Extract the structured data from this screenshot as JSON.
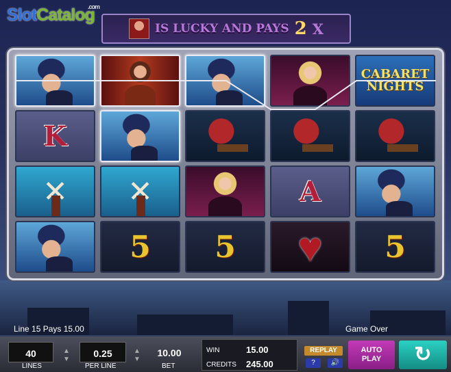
{
  "watermark": {
    "part1": "Slot",
    "part2": "Catalog",
    "suffix": ".com"
  },
  "banner": {
    "text": "IS LUCKY AND PAYS",
    "multiplier": "2",
    "x": "X"
  },
  "reels": [
    [
      {
        "symbol": "man",
        "win": true
      },
      {
        "symbol": "dancer",
        "win": true
      },
      {
        "symbol": "man",
        "win": true
      },
      {
        "symbol": "blonde",
        "win": false
      },
      {
        "symbol": "logo",
        "win": false
      }
    ],
    [
      {
        "symbol": "card",
        "label": "K",
        "win": false
      },
      {
        "symbol": "man",
        "win": true
      },
      {
        "symbol": "phonograph",
        "win": false
      },
      {
        "symbol": "phonograph",
        "win": false
      },
      {
        "symbol": "phonograph",
        "win": false
      }
    ],
    [
      {
        "symbol": "windmill",
        "win": false
      },
      {
        "symbol": "windmill",
        "win": false
      },
      {
        "symbol": "blonde",
        "win": false
      },
      {
        "symbol": "card",
        "label": "A",
        "win": false
      },
      {
        "symbol": "man",
        "win": false
      }
    ],
    [
      {
        "symbol": "man",
        "win": false
      },
      {
        "symbol": "five",
        "label": "5",
        "win": false
      },
      {
        "symbol": "five",
        "label": "5",
        "win": false
      },
      {
        "symbol": "heart",
        "win": false
      },
      {
        "symbol": "five",
        "label": "5",
        "win": false
      }
    ]
  ],
  "logo_symbol": {
    "line1": "CABARET",
    "line2": "NIGHTS"
  },
  "status": {
    "line_pays": "Line 15 Pays 15.00",
    "game_state": "Game Over"
  },
  "controls": {
    "lines": {
      "value": "40",
      "label": "LINES"
    },
    "per_line": {
      "value": "0.25",
      "label": "PER LINE"
    },
    "bet": {
      "value": "10.00",
      "label": "BET"
    },
    "win_label": "WIN",
    "win_value": "15.00",
    "credits_label": "CREDITS",
    "credits_value": "245.00",
    "replay": "REPLAY",
    "help": "?",
    "sound_icon": "speaker-icon",
    "autoplay_1": "AUTO",
    "autoplay_2": "PLAY",
    "spin_icon": "refresh-arrow-icon"
  },
  "colors": {
    "accent": "#b778d9",
    "multiplier": "#ffd76a",
    "autoplay": "#c23ab8",
    "spin": "#2ad1c3"
  }
}
